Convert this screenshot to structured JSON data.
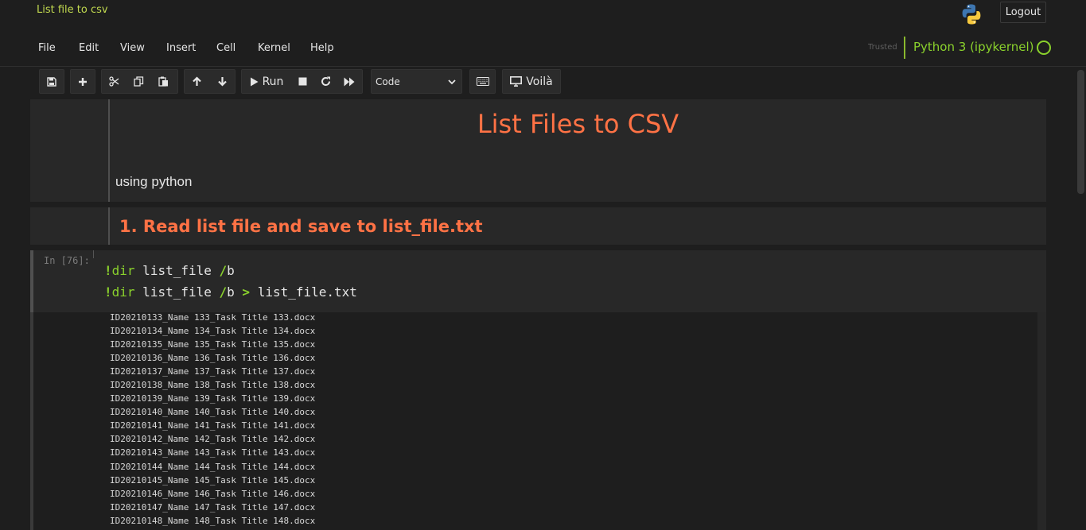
{
  "header": {
    "notebook_name": "List file to csv",
    "logout_label": "Logout",
    "trusted_label": "Trusted",
    "kernel_name": "Python 3 (ipykernel)"
  },
  "menu": [
    "File",
    "Edit",
    "View",
    "Insert",
    "Cell",
    "Kernel",
    "Help"
  ],
  "toolbar": {
    "run_label": "Run",
    "cell_type": "Code",
    "voila_label": "Voilà"
  },
  "cells": {
    "title": "List Files to CSV",
    "subtitle": "using python",
    "heading": "1. Read list file and save to list_file.txt",
    "prompt": "In [76]:",
    "code": {
      "line1": {
        "bang": "!",
        "cmd": "dir",
        "arg": " list_file ",
        "flag": "/",
        "flag_rest": "b"
      },
      "line2": {
        "bang": "!",
        "cmd": "dir",
        "arg": " list_file ",
        "flag": "/",
        "flag_rest": "b ",
        "redirect": ">",
        "target": " list_file.txt"
      }
    },
    "output": [
      "ID20210133_Name 133_Task Title 133.docx",
      "ID20210134_Name 134_Task Title 134.docx",
      "ID20210135_Name 135_Task Title 135.docx",
      "ID20210136_Name 136_Task Title 136.docx",
      "ID20210137_Name 137_Task Title 137.docx",
      "ID20210138_Name 138_Task Title 138.docx",
      "ID20210139_Name 139_Task Title 139.docx",
      "ID20210140_Name 140_Task Title 140.docx",
      "ID20210141_Name 141_Task Title 141.docx",
      "ID20210142_Name 142_Task Title 142.docx",
      "ID20210143_Name 143_Task Title 143.docx",
      "ID20210144_Name 144_Task Title 144.docx",
      "ID20210145_Name 145_Task Title 145.docx",
      "ID20210146_Name 146_Task Title 146.docx",
      "ID20210147_Name 147_Task Title 147.docx",
      "ID20210148_Name 148_Task Title 148.docx"
    ]
  },
  "colors": {
    "accent_green": "#8ad12c",
    "heading_orange": "#ff7245",
    "notebook_name": "#c1d94f"
  }
}
